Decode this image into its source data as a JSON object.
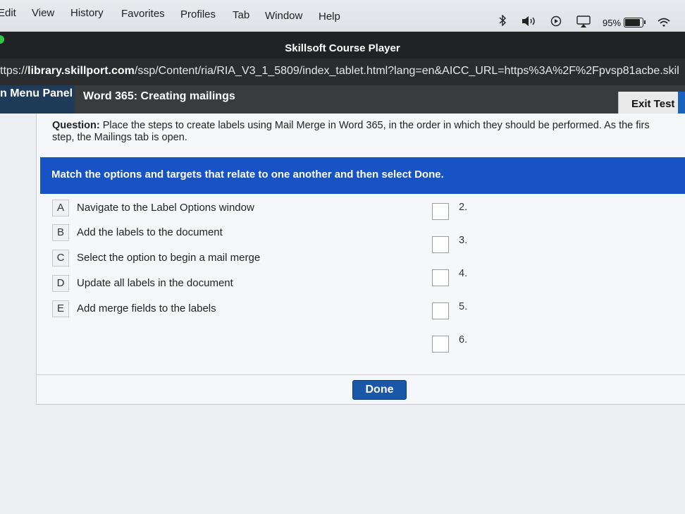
{
  "menubar": {
    "items": [
      "Edit",
      "View",
      "History",
      "Favorites",
      "Profiles",
      "Tab",
      "Window",
      "Help"
    ],
    "battery_percent": "95%",
    "battery_level": 0.95,
    "icons": [
      "bluetooth-icon",
      "volume-icon",
      "play-icon",
      "airplay-icon",
      "battery-icon",
      "wifi-icon"
    ]
  },
  "window": {
    "title": "Skillsoft Course Player"
  },
  "urlbar": {
    "prefix": "ttps://",
    "domain": "library.skillport.com",
    "path": "/ssp/Content/ria/RIA_V3_1_5809/index_tablet.html?lang=en&AICC_URL=https%3A%2F%2Fpvsp81acbe.skil"
  },
  "course": {
    "menu_panel_label": "n Menu Panel",
    "title": "Word 365: Creating mailings",
    "exit_label": "Exit Test"
  },
  "question": {
    "label": "Question:",
    "line1": " Place the steps to create labels using Mail Merge in Word 365, in the order in which they should be performed. As the firs",
    "line2": "step, the Mailings tab is open."
  },
  "instruction": {
    "text": "Match the options and targets that relate to one another and then select ",
    "emphasis": "Done."
  },
  "options": [
    {
      "letter": "A",
      "text": "Navigate to the Label Options window"
    },
    {
      "letter": "B",
      "text": "Add the labels to the document"
    },
    {
      "letter": "C",
      "text": "Select the option to begin a mail merge"
    },
    {
      "letter": "D",
      "text": "Update all labels in the document"
    },
    {
      "letter": "E",
      "text": "Add merge fields to the labels"
    }
  ],
  "targets": [
    "2.",
    "3.",
    "4.",
    "5.",
    "6."
  ],
  "done_label": "Done",
  "colors": {
    "instruction_bar": "#1753c4",
    "done_button": "#1a57a8",
    "menu_panel": "#1f3b5a"
  }
}
